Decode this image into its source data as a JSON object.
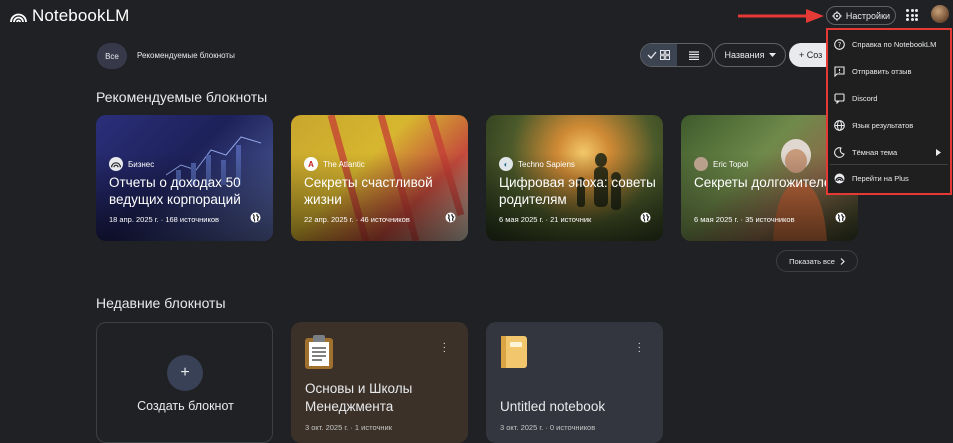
{
  "app": {
    "title": "NotebookLM"
  },
  "header": {
    "settings_label": "Настройки"
  },
  "filters": {
    "all": "Все",
    "recommended": "Рекомендуемые блокноты",
    "sort_label": "Названия",
    "create_label": "+ Соз"
  },
  "featured": {
    "title": "Рекомендуемые блокноты",
    "show_all": "Показать все",
    "cards": [
      {
        "source": "Бизнес",
        "title": "Отчеты о доходах 50 ведущих корпораций",
        "meta": "18 апр. 2025 г. · 168 источников"
      },
      {
        "source": "The Atlantic",
        "title": "Секреты счастливой жизни",
        "meta": "22 апр. 2025 г. · 46 источников"
      },
      {
        "source": "Techno Sapiens",
        "title": "Цифровая эпоха: советы родителям",
        "meta": "6 мая 2025 г. · 21 источник"
      },
      {
        "source": "Eric Topol",
        "title": "Секреты долгожителей",
        "meta": "6 мая 2025 г. · 35 источников"
      }
    ]
  },
  "recent": {
    "title": "Недавние блокноты",
    "create_label": "Создать блокнот",
    "notebooks": [
      {
        "icon": "clipboard-icon",
        "title": "Основы и Школы Менеджмента",
        "meta": "3 окт. 2025 г. · 1 источник"
      },
      {
        "icon": "notebook-icon",
        "title": "Untitled notebook",
        "meta": "3 окт. 2025 г. · 0 источников"
      }
    ]
  },
  "settings_menu": {
    "items": [
      {
        "icon": "help-icon",
        "label": "Справка по NotebookLM"
      },
      {
        "icon": "feedback-icon",
        "label": "Отправить отзыв"
      },
      {
        "icon": "discord-icon",
        "label": "Discord"
      },
      {
        "icon": "language-icon",
        "label": "Язык результатов"
      },
      {
        "icon": "moon-icon",
        "label": "Тёмная тема"
      },
      {
        "icon": "plus-plan-icon",
        "label": "Перейти на Plus"
      }
    ]
  },
  "colors": {
    "background": "#202124",
    "highlight": "#e53935"
  }
}
